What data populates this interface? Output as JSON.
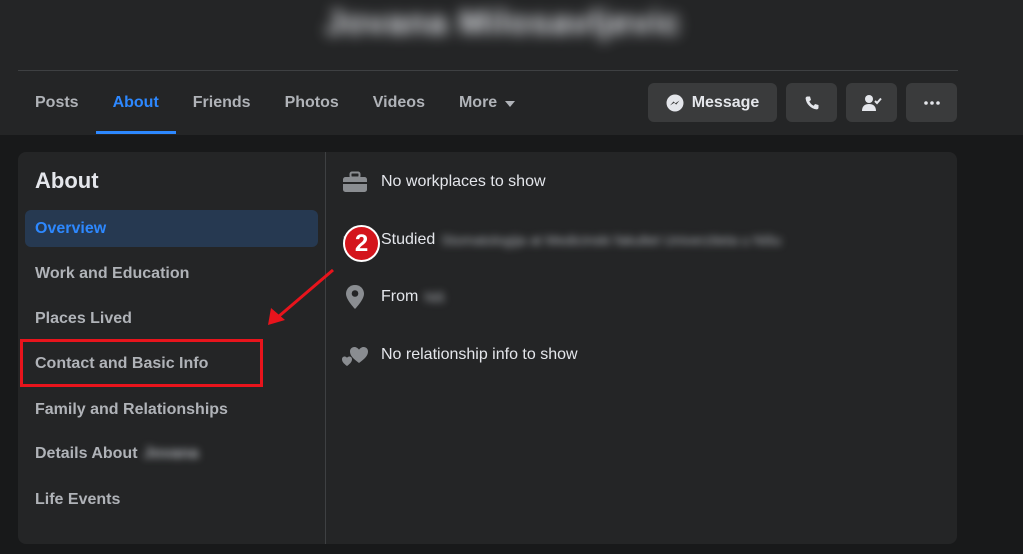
{
  "profile": {
    "name": "Jovana Milosavljevic"
  },
  "tabs": [
    {
      "label": "Posts",
      "active": false
    },
    {
      "label": "About",
      "active": true
    },
    {
      "label": "Friends",
      "active": false
    },
    {
      "label": "Photos",
      "active": false
    },
    {
      "label": "Videos",
      "active": false
    },
    {
      "label": "More",
      "active": false
    }
  ],
  "actions": {
    "message_label": "Message",
    "call_icon": "phone-icon",
    "friend_icon": "friend-check-icon",
    "more_icon": "ellipsis-icon"
  },
  "about": {
    "title": "About",
    "items": [
      {
        "label": "Overview",
        "active": true
      },
      {
        "label": "Work and Education"
      },
      {
        "label": "Places Lived"
      },
      {
        "label": "Contact and Basic Info"
      },
      {
        "label": "Family and Relationships"
      },
      {
        "label": "Details About",
        "blurred_suffix": "Jovana"
      },
      {
        "label": "Life Events"
      }
    ]
  },
  "overview": {
    "work": "No workplaces to show",
    "education_prefix": "Studied",
    "education_blurred": "Stomatologija at Medicinski fakultet Univerziteta u Nišu",
    "from_prefix": "From",
    "from_blurred": "Niš",
    "relationship": "No relationship info to show"
  },
  "annotation": {
    "step_number": "2",
    "color": "#e8141c"
  },
  "colors": {
    "accent": "#2d88ff",
    "panel": "#242526",
    "background": "#18191a"
  }
}
